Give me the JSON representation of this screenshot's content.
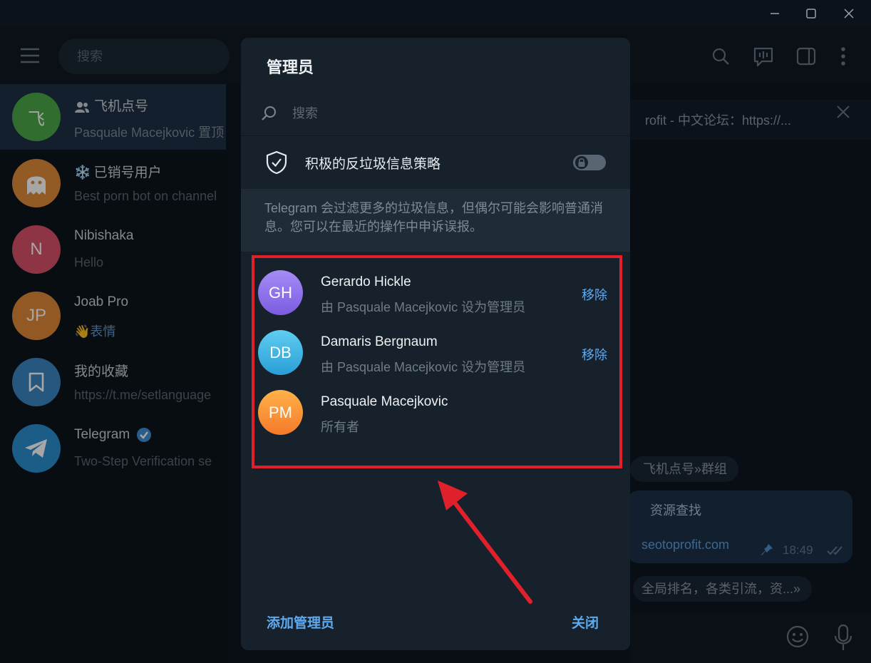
{
  "header": {
    "search_placeholder": "搜索"
  },
  "chats": [
    {
      "name": "飞机点号",
      "preview": "Pasquale Macejkovic 置顶",
      "avatar_letter": "飞",
      "avatar_color": "#4da84a",
      "group": true
    },
    {
      "name": "已销号用户",
      "preview": "Best porn bot on channel",
      "avatar_color": "#e08a3a",
      "prefix_emoji": "❄️"
    },
    {
      "name": "Nibishaka",
      "preview": "Hello",
      "avatar_letter": "N",
      "avatar_color": "#d9506a"
    },
    {
      "name": "Joab Pro",
      "preview": "表情",
      "preview_emoji": "👋",
      "avatar_letter": "JP",
      "avatar_color": "#e0893a"
    },
    {
      "name": "我的收藏",
      "preview": "https://t.me/setlanguage",
      "avatar_color": "#3b86c4"
    },
    {
      "name": "Telegram",
      "preview": "Two-Step Verification se",
      "avatar_color": "#2a8fd0",
      "verified": true
    }
  ],
  "chat_area": {
    "pinned_text": "rofit - 中文论坛：https://...",
    "service_message_1": "飞机点号»群组",
    "message_text": "资源查找",
    "message_link": "seotoprofit.com",
    "message_time": "18:49",
    "service_message_2": "全局排名，各类引流，资...»"
  },
  "modal": {
    "title": "管理员",
    "search_placeholder": "搜索",
    "antispam_label": "积极的反垃圾信息策略",
    "antispam_enabled": false,
    "note": "Telegram 会过滤更多的垃圾信息，但偶尔可能会影响普通消息。您可以在最近的操作中申诉误报。",
    "admins": [
      {
        "initials": "GH",
        "name": "Gerardo Hickle",
        "subtitle": "由 Pasquale Macejkovic 设为管理员",
        "remove_label": "移除",
        "color_top": "#a58cf5",
        "color_bottom": "#7b5ce0"
      },
      {
        "initials": "DB",
        "name": "Damaris Bergnaum",
        "subtitle": "由 Pasquale Macejkovic 设为管理员",
        "remove_label": "移除",
        "color_top": "#5fcdf2",
        "color_bottom": "#2a9ed6"
      },
      {
        "initials": "PM",
        "name": "Pasquale Macejkovic",
        "subtitle": "所有者",
        "remove_label": "",
        "color_top": "#ffb24a",
        "color_bottom": "#f47a2a"
      }
    ],
    "add_admin_label": "添加管理员",
    "close_label": "关闭"
  },
  "annotation": {
    "highlight_color": "#e0202b"
  }
}
